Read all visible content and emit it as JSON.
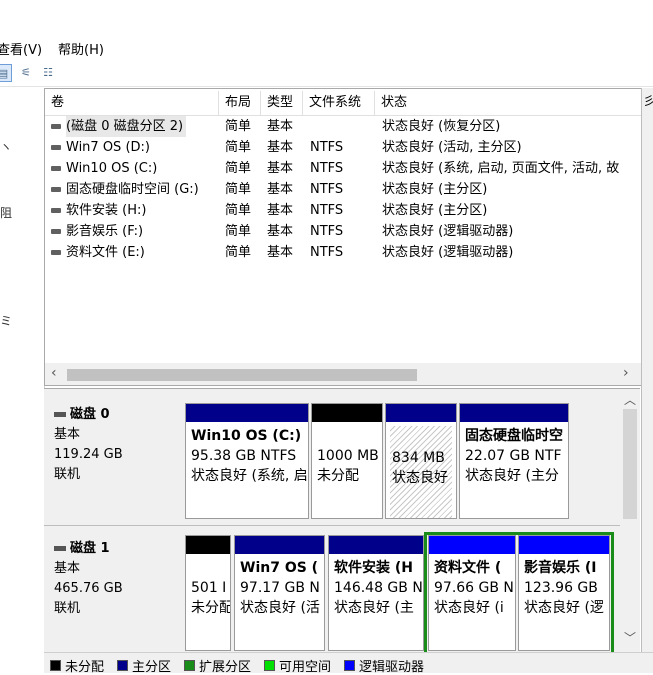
{
  "menu": {
    "view": "查看(V)",
    "help": "帮助(H)"
  },
  "left_glyphs": [
    "ヽ",
    "阻",
    "ミ"
  ],
  "columns": [
    "卷",
    "布局",
    "类型",
    "文件系统",
    "状态",
    "彡"
  ],
  "volumes": [
    {
      "name": "(磁盘 0 磁盘分区 2)",
      "layout": "简单",
      "type": "基本",
      "fs": "",
      "status": "状态良好 (恢复分区)"
    },
    {
      "name": "Win7 OS (D:)",
      "layout": "简单",
      "type": "基本",
      "fs": "NTFS",
      "status": "状态良好 (活动, 主分区)"
    },
    {
      "name": "Win10 OS (C:)",
      "layout": "简单",
      "type": "基本",
      "fs": "NTFS",
      "status": "状态良好 (系统, 启动, 页面文件, 活动, 故"
    },
    {
      "name": "固态硬盘临时空间 (G:)",
      "layout": "简单",
      "type": "基本",
      "fs": "NTFS",
      "status": "状态良好 (主分区)"
    },
    {
      "name": "软件安装 (H:)",
      "layout": "简单",
      "type": "基本",
      "fs": "NTFS",
      "status": "状态良好 (主分区)"
    },
    {
      "name": "影音娱乐 (F:)",
      "layout": "简单",
      "type": "基本",
      "fs": "NTFS",
      "status": "状态良好 (逻辑驱动器)"
    },
    {
      "name": "资料文件 (E:)",
      "layout": "简单",
      "type": "基本",
      "fs": "NTFS",
      "status": "状态良好 (逻辑驱动器)"
    }
  ],
  "disks": [
    {
      "name": "磁盘 0",
      "kind": "基本",
      "size": "119.24 GB",
      "state": "联机",
      "partitions": [
        {
          "title": "Win10 OS  (C:)",
          "size": "95.38 GB NTFS",
          "status": "状态良好 (系统, 启"
        },
        {
          "title": "",
          "size": "1000 MB",
          "status": "未分配"
        },
        {
          "title": "",
          "size": "834 MB",
          "status": "状态良好"
        },
        {
          "title": "固态硬盘临时空",
          "size": "22.07 GB NTF",
          "status": "状态良好 (主分"
        }
      ]
    },
    {
      "name": "磁盘 1",
      "kind": "基本",
      "size": "465.76 GB",
      "state": "联机",
      "partitions": [
        {
          "title": "",
          "size": "501 I",
          "status": "未分配"
        },
        {
          "title": "Win7 OS  (",
          "size": "97.17 GB N",
          "status": "状态良好 (活"
        },
        {
          "title": "软件安装  (H",
          "size": "146.48 GB N",
          "status": "状态良好 (主"
        },
        {
          "title": "资料文件  (",
          "size": "97.66 GB N",
          "status": "状态良好 (i"
        },
        {
          "title": "影音娱乐  (I",
          "size": "123.96 GB",
          "status": "状态良好 (逻"
        }
      ]
    }
  ],
  "legend": [
    "未分配",
    "主分区",
    "扩展分区",
    "可用空间",
    "逻辑驱动器"
  ],
  "colors": {
    "unallocated": "#000000",
    "primary": "#00008b",
    "extended": "#1a8c1a",
    "free": "#00e000",
    "logical": "#0000ff"
  }
}
